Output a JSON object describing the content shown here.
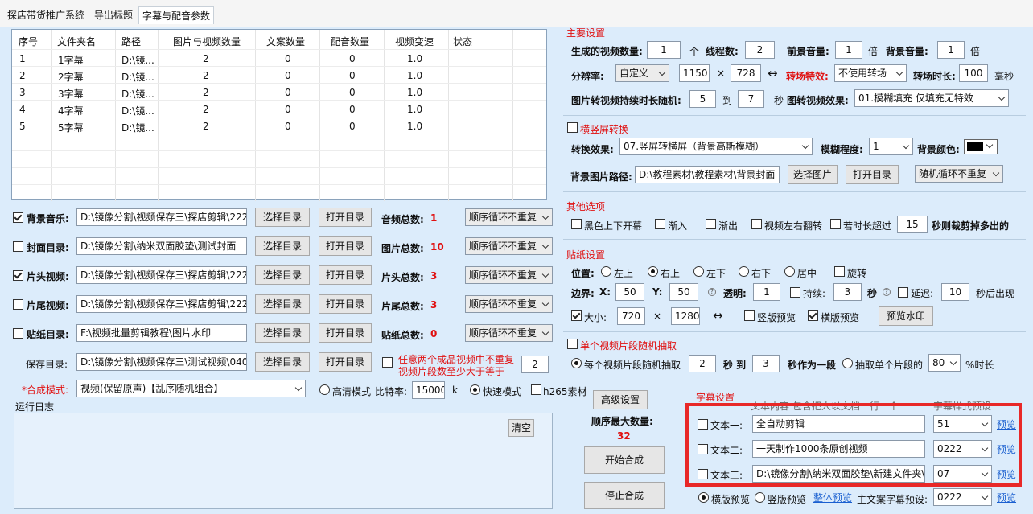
{
  "tabs": [
    "探店带货推广系统",
    "导出标题",
    "字幕与配音参数"
  ],
  "list": {
    "headers": [
      "序号",
      "文件夹名",
      "路径",
      "图片与视频数量",
      "文案数量",
      "配音数量",
      "视频变速",
      "状态"
    ],
    "rows": [
      [
        "1",
        "1字幕",
        "D:\\镜...",
        "2",
        "0",
        "0",
        "1.0"
      ],
      [
        "2",
        "2字幕",
        "D:\\镜...",
        "2",
        "0",
        "0",
        "1.0"
      ],
      [
        "3",
        "3字幕",
        "D:\\镜...",
        "2",
        "0",
        "0",
        "1.0"
      ],
      [
        "4",
        "4字幕",
        "D:\\镜...",
        "2",
        "0",
        "0",
        "1.0"
      ],
      [
        "5",
        "5字幕",
        "D:\\镜...",
        "2",
        "0",
        "0",
        "1.0"
      ]
    ]
  },
  "dirs": [
    {
      "label": "背景音乐:",
      "checked": true,
      "path": "D:\\镜像分割\\视频保存三\\探店剪辑\\222",
      "count_label": "音频总数:",
      "count": "1",
      "mode": "顺序循环不重复"
    },
    {
      "label": "封面目录:",
      "checked": false,
      "path": "D:\\镜像分割\\纳米双面胶垫\\测试封面",
      "count_label": "图片总数:",
      "count": "10",
      "mode": "顺序循环不重复"
    },
    {
      "label": "片头视频:",
      "checked": true,
      "path": "D:\\镜像分割\\视频保存三\\探店剪辑\\222",
      "count_label": "片头总数:",
      "count": "3",
      "mode": "顺序循环不重复"
    },
    {
      "label": "片尾视频:",
      "checked": false,
      "path": "D:\\镜像分割\\视频保存三\\探店剪辑\\222",
      "count_label": "片尾总数:",
      "count": "3",
      "mode": "顺序循环不重复"
    },
    {
      "label": "贴纸目录:",
      "checked": false,
      "path": "F:\\视频批量剪辑教程\\图片水印",
      "count_label": "贴纸总数:",
      "count": "0",
      "mode": "顺序循环不重复"
    }
  ],
  "btn_select_dir": "选择目录",
  "btn_open_dir": "打开目录",
  "save": {
    "label": "保存目录:",
    "path": "D:\\镜像分割\\视频保存三\\测试视频\\040",
    "no_repeat_1": "任意两个成品视频中不重复",
    "no_repeat_2": "视频片段数至少大于等于",
    "no_repeat_val": "2"
  },
  "compose": {
    "label": "*合成模式:",
    "mode": "视频(保留原声)【乱序随机组合】",
    "hq": "高清模式",
    "bitrate_label": "比特率:",
    "bitrate": "15000",
    "k": "k",
    "fast": "快速模式",
    "h265": "h265素材"
  },
  "log": {
    "label": "运行日志",
    "clear": "清空"
  },
  "actions": {
    "advanced": "高级设置",
    "max_label": "顺序最大数量:",
    "max_val": "32",
    "start": "开始合成",
    "stop": "停止合成"
  },
  "main": {
    "title": "主要设置",
    "gen_label": "生成的视频数量:",
    "gen_val": "1",
    "unit_ge": "个",
    "thread_label": "线程数:",
    "thread_val": "2",
    "fg_label": "前景音量:",
    "fg_val": "1",
    "bei": "倍",
    "bg_label": "背景音量:",
    "bg_val": "1",
    "bei2": "倍",
    "res_label": "分辨率:",
    "res_mode": "自定义",
    "w": "1150",
    "x": "×",
    "h": "728",
    "arrow": "↔",
    "trans_label": "转场特效:",
    "trans_val": "不使用转场",
    "trans_dur_label": "转场时长:",
    "trans_dur": "100",
    "ms": "毫秒",
    "img_label": "图片转视频持续时长随机:",
    "img_from": "5",
    "to": "到",
    "img_to": "7",
    "sec": "秒",
    "img_effect_label": "图转视频效果:",
    "img_effect": "01.模糊填充 仅填充无特效"
  },
  "hv": {
    "title": "横竖屏转换",
    "effect_label": "转换效果:",
    "effect": "07.竖屏转横屏（背景高斯模糊）",
    "blur_label": "模糊程度:",
    "blur": "1",
    "color_label": "背景颜色:",
    "bgpath_label": "背景图片路径:",
    "bgpath": "D:\\教程素材\\教程素材\\背景封面",
    "pick": "选择图片",
    "open": "打开目录",
    "mode": "随机循环不重复"
  },
  "other": {
    "title": "其他选项",
    "o1": "黑色上下开幕",
    "o2": "渐入",
    "o3": "渐出",
    "o4": "视频左右翻转",
    "o5": "若时长超过",
    "o5_val": "15",
    "o5_tail": "秒则裁剪掉多出的"
  },
  "sticker": {
    "title": "贴纸设置",
    "pos_label": "位置:",
    "positions": [
      "左上",
      "右上",
      "左下",
      "右下",
      "居中"
    ],
    "rotate": "旋转",
    "bx_label": "边界:",
    "x_label": "X:",
    "x": "50",
    "y_label": "Y:",
    "y": "50",
    "trans_label": "透明:",
    "trans": "1",
    "dur_label": "持续:",
    "dur": "3",
    "sec": "秒",
    "delay_label": "延迟:",
    "delay": "10",
    "delay_tail": "秒后出现",
    "size_label": "大小:",
    "sw": "720",
    "times": "×",
    "sh": "1280",
    "arrow": "↔",
    "vpreview": "竖版预览",
    "hpreview": "横版预览",
    "preview_btn": "预览水印"
  },
  "clip": {
    "title": "单个视频片段随机抽取",
    "each": "每个视频片段随机抽取",
    "from": "2",
    "to": "秒 到",
    "to_val": "3",
    "tail": "秒作为一段",
    "single": "抽取单个片段的",
    "pct": "80",
    "pct_tail": "%时长"
  },
  "subs": {
    "title": "字幕设置",
    "hdr_text": "文本内容 包含把人以文档一行一个",
    "hdr_style": "字幕样式预设",
    "rows": [
      {
        "label": "文本一:",
        "text": "全自动剪辑",
        "style": "51"
      },
      {
        "label": "文本二:",
        "text": "一天制作1000条原创视频",
        "style": "0222"
      },
      {
        "label": "文本三:",
        "text": "D:\\镜像分割\\纳米双面胶垫\\新建文件夹\\",
        "style": "07"
      }
    ],
    "preview": "预览",
    "hprev": "横版预览",
    "vprev": "竖版预览",
    "whole": "整体预览",
    "main_label": "主文案字幕预设:",
    "main_val": "0222"
  }
}
